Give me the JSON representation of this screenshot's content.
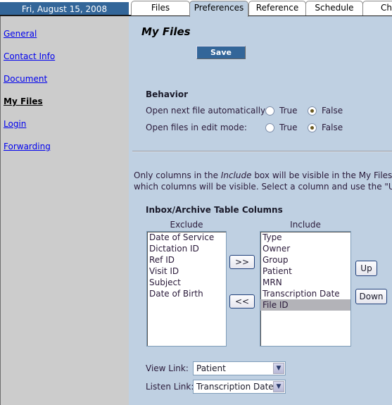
{
  "header": {
    "date": "Fri, August 15, 2008",
    "tabs": [
      {
        "label": "Files",
        "active": false
      },
      {
        "label": "Preferences",
        "active": true
      },
      {
        "label": "Reference",
        "active": false
      },
      {
        "label": "Schedule",
        "active": false
      },
      {
        "label": "Cha",
        "active": false
      }
    ]
  },
  "sidebar": {
    "items": [
      {
        "label": "General",
        "active": false
      },
      {
        "label": "Contact Info",
        "active": false
      },
      {
        "label": "Document",
        "active": false
      },
      {
        "label": "My Files",
        "active": true
      },
      {
        "label": "Login",
        "active": false
      },
      {
        "label": "Forwarding",
        "active": false
      }
    ]
  },
  "main": {
    "title": "My Files",
    "save_label": "Save",
    "behavior": {
      "title": "Behavior",
      "rows": [
        {
          "label": "Open next file automatically:",
          "true_label": "True",
          "false_label": "False",
          "selected": "False"
        },
        {
          "label": "Open files in edit mode:",
          "true_label": "True",
          "false_label": "False",
          "selected": "False"
        }
      ]
    },
    "info": {
      "line1_pre": "Only columns in the ",
      "line1_em": "Include",
      "line1_post": " box will be visible in the My Files sec",
      "line2": "which columns will be visible. Select a column and use the \"Up\""
    },
    "columns": {
      "title": "Inbox/Archive Table Columns",
      "exclude_label": "Exclude",
      "include_label": "Include",
      "exclude": [
        "Date of Service",
        "Dictation ID",
        "Ref ID",
        "Visit ID",
        "Subject",
        "Date of Birth"
      ],
      "include": [
        "Type",
        "Owner",
        "Group",
        "Patient",
        "MRN",
        "Transcription Date",
        "File ID"
      ],
      "include_selected": "File ID",
      "add_label": ">>",
      "remove_label": "<<",
      "up_label": "Up",
      "down_label": "Down"
    },
    "links": {
      "view_label": "View Link:",
      "view_value": "Patient",
      "listen_label": "Listen Link:",
      "listen_value": "Transcription Date"
    }
  }
}
